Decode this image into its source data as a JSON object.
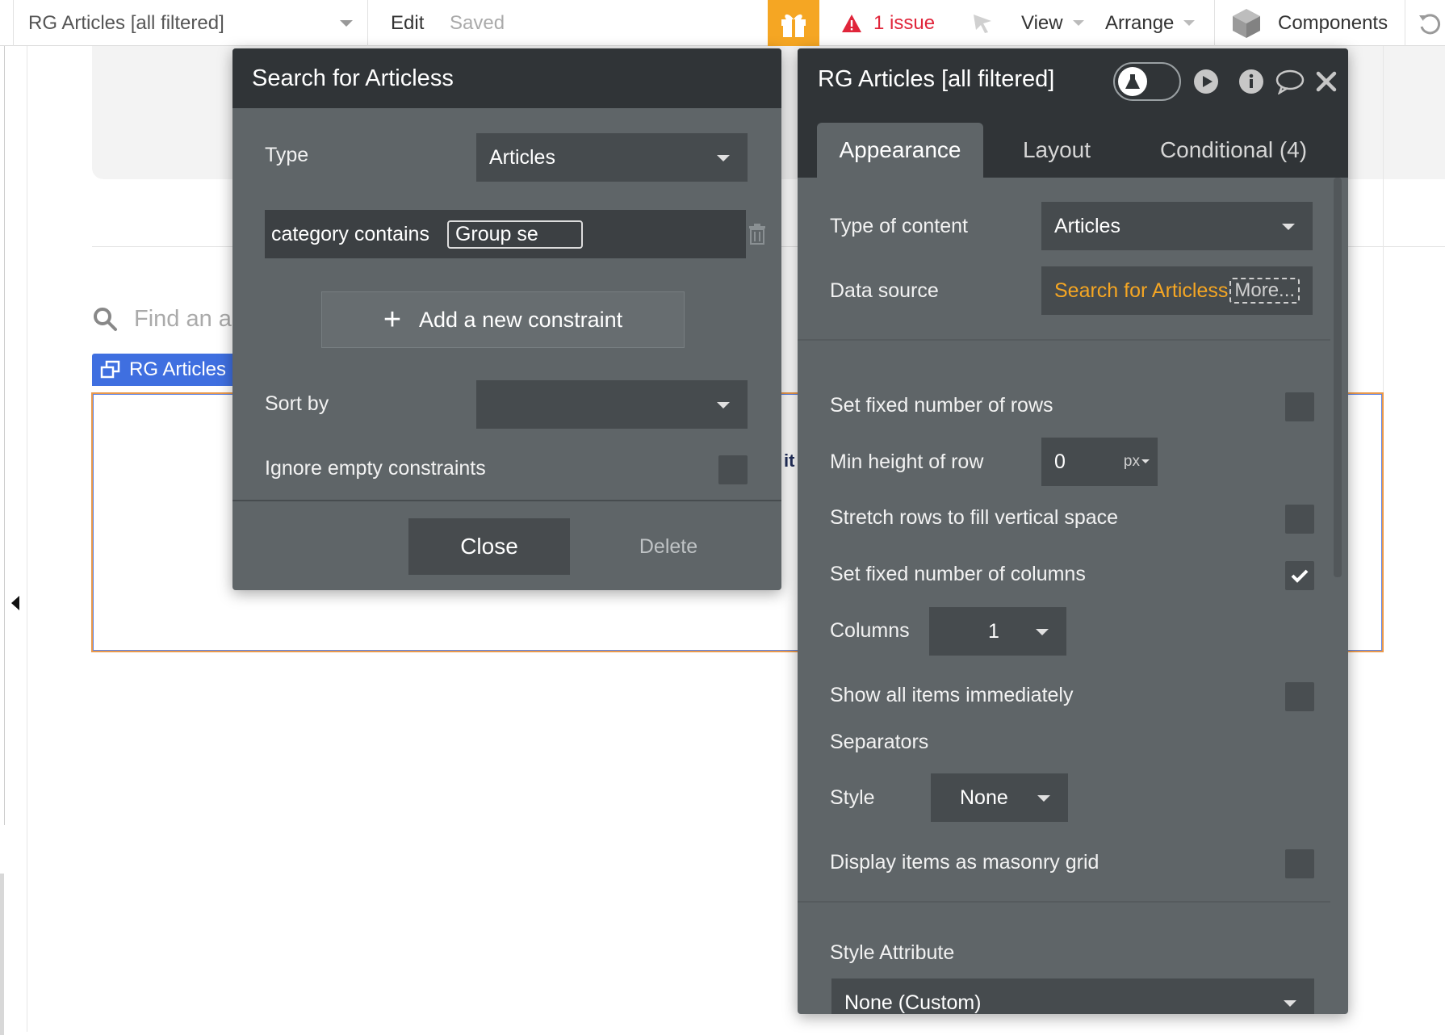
{
  "topbar": {
    "page_name": "RG Articles [all filtered]",
    "edit_label": "Edit",
    "saved_label": "Saved",
    "issues_label": "1 issue",
    "view_label": "View",
    "arrange_label": "Arrange",
    "components_label": "Components",
    "colors": {
      "gift": "#f5a623",
      "issue": "#e0253a"
    }
  },
  "canvas": {
    "search_placeholder": "Find an a",
    "rg_tag_label": "RG Articles",
    "snippet_text": "it"
  },
  "search_dialog": {
    "title": "Search for Articless",
    "type_label": "Type",
    "type_value": "Articles",
    "constraint_label": "category contains",
    "constraint_value": "Group se",
    "add_constraint_label": "Add a new constraint",
    "sort_by_label": "Sort by",
    "sort_by_value": "",
    "ignore_empty_label": "Ignore empty constraints",
    "ignore_empty_checked": false,
    "close_label": "Close",
    "delete_label": "Delete"
  },
  "property_editor": {
    "title": "RG Articles [all filtered]",
    "tabs": [
      {
        "label": "Appearance",
        "active": true
      },
      {
        "label": "Layout",
        "active": false
      },
      {
        "label": "Conditional (4)",
        "active": false
      }
    ],
    "type_of_content_label": "Type of content",
    "type_of_content_value": "Articles",
    "data_source_label": "Data source",
    "data_source_value": "Search for Articless",
    "data_source_more": "More...",
    "fixed_rows_label": "Set fixed number of rows",
    "fixed_rows_checked": false,
    "min_height_label": "Min height of row",
    "min_height_value": "0",
    "min_height_unit": "px",
    "stretch_rows_label": "Stretch rows to fill vertical space",
    "stretch_rows_checked": false,
    "fixed_columns_label": "Set fixed number of columns",
    "fixed_columns_checked": true,
    "columns_label": "Columns",
    "columns_value": "1",
    "show_all_label": "Show all items immediately",
    "show_all_checked": false,
    "separators_label": "Separators",
    "style_label": "Style",
    "style_value": "None",
    "masonry_label": "Display items as masonry grid",
    "masonry_checked": false,
    "style_attribute_label": "Style Attribute",
    "style_attribute_value": "None (Custom)"
  }
}
